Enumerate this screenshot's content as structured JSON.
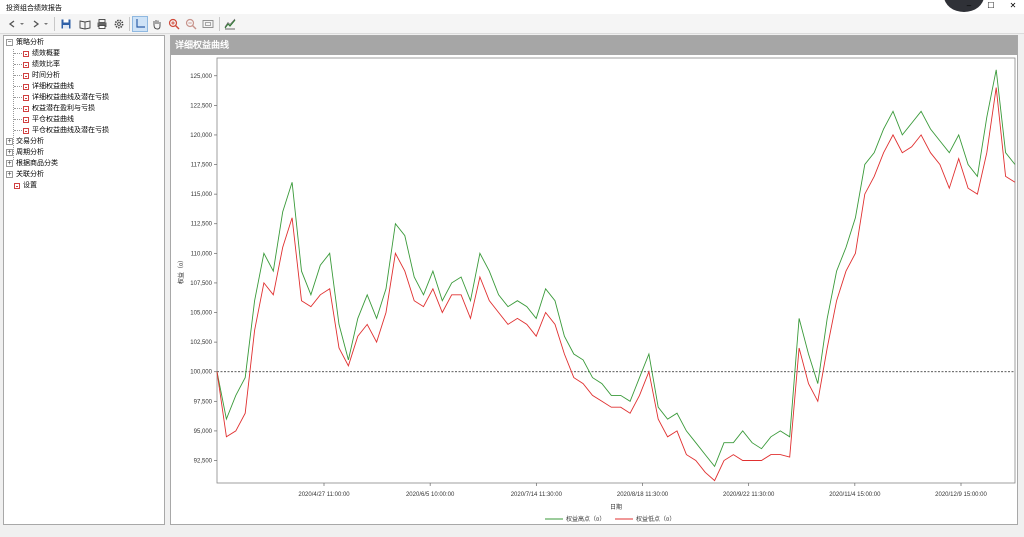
{
  "window": {
    "title": "投资组合绩效报告",
    "minimize": "–",
    "maximize": "☐",
    "close": "✕"
  },
  "toolbar": {
    "back_icon": "arrow-left-icon",
    "forward_icon": "arrow-right-icon",
    "tools": [
      "save-icon",
      "book-icon",
      "print-icon",
      "settings-icon",
      "crosshair-icon",
      "hand-icon",
      "zoom-in-icon",
      "zoom-out-icon",
      "fit-icon",
      "chart-icon"
    ]
  },
  "tree": {
    "nodes": [
      {
        "label": "策略分析",
        "kind": "group",
        "expanded": true
      },
      {
        "label": "绩效概要",
        "kind": "leaf"
      },
      {
        "label": "绩效比率",
        "kind": "leaf"
      },
      {
        "label": "时间分析",
        "kind": "leaf"
      },
      {
        "label": "详细权益曲线",
        "kind": "leaf"
      },
      {
        "label": "详细权益曲线及潜在亏损",
        "kind": "leaf"
      },
      {
        "label": "权益潜在盈利与亏损",
        "kind": "leaf"
      },
      {
        "label": "平仓权益曲线",
        "kind": "leaf"
      },
      {
        "label": "平仓权益曲线及潜在亏损",
        "kind": "leaf"
      },
      {
        "label": "交易分析",
        "kind": "group",
        "expanded": false
      },
      {
        "label": "周期分析",
        "kind": "group",
        "expanded": false
      },
      {
        "label": "根据商品分类",
        "kind": "group",
        "expanded": false
      },
      {
        "label": "关联分析",
        "kind": "group",
        "expanded": false
      },
      {
        "label": "设置",
        "kind": "root-leaf"
      }
    ]
  },
  "panel": {
    "title": "详细权益曲线"
  },
  "chart_data": {
    "type": "line",
    "ylabel": "权益（¤）",
    "xlabel": "日期",
    "ylim": [
      90600,
      126500
    ],
    "yticks": [
      92500,
      95000,
      97500,
      100000,
      102500,
      105000,
      107500,
      110000,
      112500,
      115000,
      117500,
      120000,
      122500,
      125000
    ],
    "ytick_labels": [
      "92,500",
      "95,000",
      "97,500",
      "100,000",
      "102,500",
      "105,000",
      "107,500",
      "110,000",
      "112,500",
      "115,000",
      "117,500",
      "120,000",
      "122,500",
      "125,000"
    ],
    "xticks": [
      "2020/4/27 11:00:00",
      "2020/6/5 10:00:00",
      "2020/7/14 11:30:00",
      "2020/8/18 11:30:00",
      "2020/9/22 11:30:00",
      "2020/11/4 15:00:00",
      "2020/12/9 15:00:00"
    ],
    "baseline": 100000,
    "grid": true,
    "legend_position": "bottom-center",
    "series": [
      {
        "name": "权益高点（¤）",
        "color": "#3a9a3a",
        "values": [
          100000,
          96000,
          98000,
          99500,
          106000,
          110000,
          108500,
          113500,
          116000,
          108500,
          106500,
          109000,
          110000,
          104000,
          101000,
          104500,
          106500,
          104500,
          107000,
          112500,
          111500,
          108000,
          106500,
          108500,
          106000,
          107500,
          108000,
          106000,
          110000,
          108500,
          106500,
          105500,
          106000,
          105500,
          104500,
          107000,
          106000,
          103000,
          101500,
          101000,
          99500,
          99000,
          98000,
          98000,
          97500,
          99500,
          101500,
          97000,
          96000,
          96500,
          95000,
          94000,
          93000,
          92000,
          94000,
          94000,
          95000,
          94000,
          93500,
          94500,
          95000,
          94500,
          104500,
          101500,
          99000,
          104500,
          108500,
          110500,
          113000,
          117500,
          118500,
          120500,
          122000,
          120000,
          121000,
          122000,
          120500,
          119500,
          118500,
          120000,
          117500,
          116500,
          121500,
          125500,
          118500,
          117500
        ]
      },
      {
        "name": "权益低点（¤）",
        "color": "#e03030",
        "values": [
          100000,
          94500,
          95000,
          96500,
          103500,
          107500,
          106500,
          110500,
          113000,
          106000,
          105500,
          106500,
          107000,
          102000,
          100500,
          103000,
          104000,
          102500,
          105000,
          110000,
          108500,
          106000,
          105500,
          107000,
          105000,
          106500,
          106500,
          104500,
          108000,
          106000,
          105000,
          104000,
          104500,
          104000,
          103000,
          105000,
          104000,
          101500,
          99500,
          99000,
          98000,
          97500,
          97000,
          97000,
          96500,
          98000,
          100000,
          96000,
          94500,
          95000,
          93000,
          92500,
          91500,
          90800,
          92500,
          93000,
          92500,
          92500,
          92500,
          93000,
          93000,
          92800,
          102000,
          99000,
          97500,
          102000,
          106000,
          108500,
          110000,
          115000,
          116500,
          118500,
          120000,
          118500,
          119000,
          120000,
          118500,
          117500,
          115500,
          118000,
          115500,
          115000,
          118500,
          124000,
          116500,
          116000
        ]
      }
    ]
  }
}
